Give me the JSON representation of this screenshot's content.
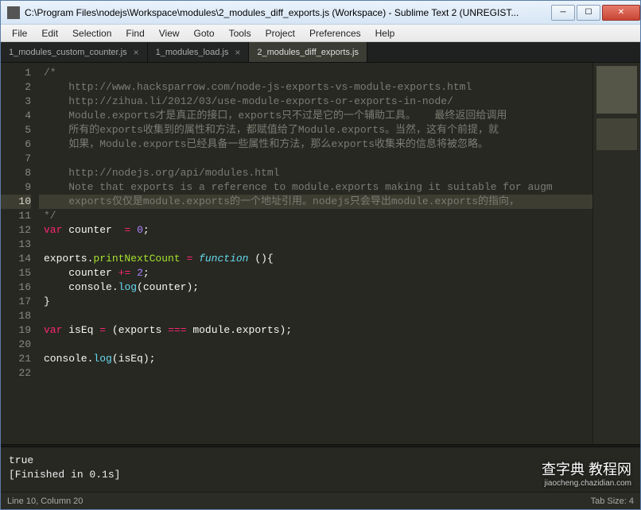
{
  "window": {
    "title": "C:\\Program Files\\nodejs\\Workspace\\modules\\2_modules_diff_exports.js (Workspace) - Sublime Text 2 (UNREGIST..."
  },
  "menu": {
    "items": [
      "File",
      "Edit",
      "Selection",
      "Find",
      "View",
      "Goto",
      "Tools",
      "Project",
      "Preferences",
      "Help"
    ]
  },
  "tabs": [
    {
      "label": "1_modules_custom_counter.js",
      "active": false
    },
    {
      "label": "1_modules_load.js",
      "active": false
    },
    {
      "label": "2_modules_diff_exports.js",
      "active": true
    }
  ],
  "code": {
    "lines": [
      {
        "n": 1,
        "type": "comment",
        "text": "/*"
      },
      {
        "n": 2,
        "type": "comment",
        "text": "    http://www.hacksparrow.com/node-js-exports-vs-module-exports.html"
      },
      {
        "n": 3,
        "type": "comment",
        "text": "    http://zihua.li/2012/03/use-module-exports-or-exports-in-node/"
      },
      {
        "n": 4,
        "type": "comment",
        "text": "    Module.exports才是真正的接口，exports只不过是它的一个辅助工具。   最终返回给调用"
      },
      {
        "n": 5,
        "type": "comment",
        "text": "    所有的exports收集到的属性和方法，都赋值给了Module.exports。当然，这有个前提，就"
      },
      {
        "n": 6,
        "type": "comment",
        "text": "    如果，Module.exports已经具备一些属性和方法，那么exports收集来的信息将被忽略。"
      },
      {
        "n": 7,
        "type": "comment",
        "text": ""
      },
      {
        "n": 8,
        "type": "comment",
        "text": "    http://nodejs.org/api/modules.html"
      },
      {
        "n": 9,
        "type": "comment",
        "text": "    Note that exports is a reference to module.exports making it suitable for augm"
      },
      {
        "n": 10,
        "type": "comment",
        "text": "    exports仅仅是module.exports的一个地址引用。nodejs只会导出module.exports的指向，",
        "hl": true
      },
      {
        "n": 11,
        "type": "comment",
        "text": "*/"
      },
      {
        "n": 12,
        "type": "vardecl",
        "kw": "var",
        "name": "counter",
        "op": "=",
        "val": "0"
      },
      {
        "n": 13,
        "type": "blank",
        "text": ""
      },
      {
        "n": 14,
        "type": "fnassign",
        "obj": "exports",
        "prop": "printNextCount",
        "op": "=",
        "fn": "function",
        "sig": "(){"
      },
      {
        "n": 15,
        "type": "stmt",
        "indent": "    ",
        "lhs": "counter",
        "op": "+=",
        "rhs": "2"
      },
      {
        "n": 16,
        "type": "call",
        "indent": "    ",
        "obj": "console",
        "method": "log",
        "arg": "counter"
      },
      {
        "n": 17,
        "type": "close",
        "text": "}"
      },
      {
        "n": 18,
        "type": "blank",
        "text": ""
      },
      {
        "n": 19,
        "type": "vardecl2",
        "kw": "var",
        "name": "isEq",
        "op": "=",
        "expr_l": "exports",
        "expr_op": "===",
        "expr_r": "module.exports"
      },
      {
        "n": 20,
        "type": "blank",
        "text": ""
      },
      {
        "n": 21,
        "type": "call",
        "indent": "",
        "obj": "console",
        "method": "log",
        "arg": "isEq"
      },
      {
        "n": 22,
        "type": "blank",
        "text": ""
      }
    ]
  },
  "console": {
    "line1": "true",
    "line2": "[Finished in 0.1s]"
  },
  "status": {
    "left": "Line 10, Column 20",
    "right": "Tab Size: 4"
  },
  "watermark": {
    "main": "查字典 教程网",
    "sub": "jiaocheng.chazidian.com"
  }
}
